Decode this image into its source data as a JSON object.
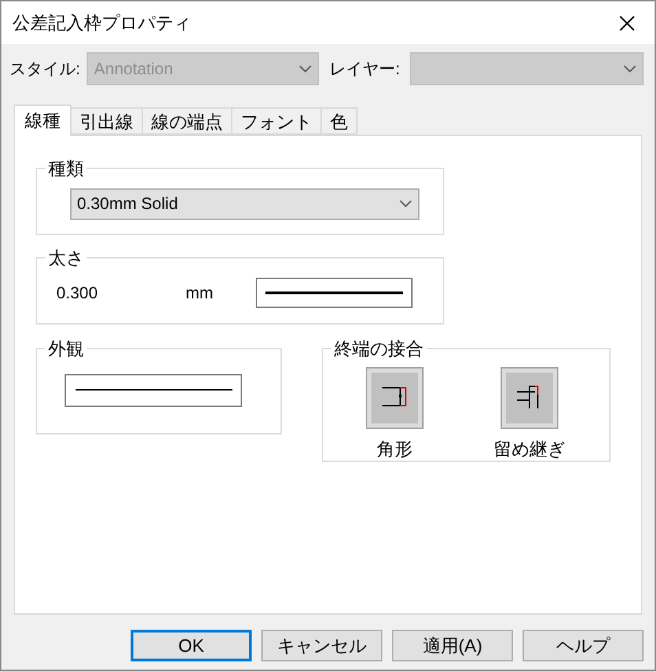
{
  "window": {
    "title": "公差記入枠プロパティ"
  },
  "style_field": {
    "label": "スタイル:",
    "value": "Annotation",
    "disabled": true
  },
  "layer_field": {
    "label": "レイヤー:",
    "disabled": true
  },
  "tabs": [
    {
      "label": "線種",
      "selected": true
    },
    {
      "label": "引出線",
      "selected": false
    },
    {
      "label": "線の端点",
      "selected": false
    },
    {
      "label": "フォント",
      "selected": false
    },
    {
      "label": "色",
      "selected": false
    }
  ],
  "type_group": {
    "title": "種類",
    "value": "0.30mm Solid"
  },
  "width_group": {
    "title": "太さ",
    "value": "0.300",
    "unit": "mm"
  },
  "appearance_group": {
    "title": "外観"
  },
  "join_group": {
    "title": "終端の接合",
    "options": [
      {
        "label": "角形",
        "kind": "square"
      },
      {
        "label": "留め継ぎ",
        "kind": "miter"
      }
    ]
  },
  "buttons": [
    {
      "label": "OK",
      "default": true
    },
    {
      "label": "キャンセル",
      "default": false
    },
    {
      "label": "適用(A)",
      "default": false
    },
    {
      "label": "ヘルプ",
      "default": false
    }
  ]
}
